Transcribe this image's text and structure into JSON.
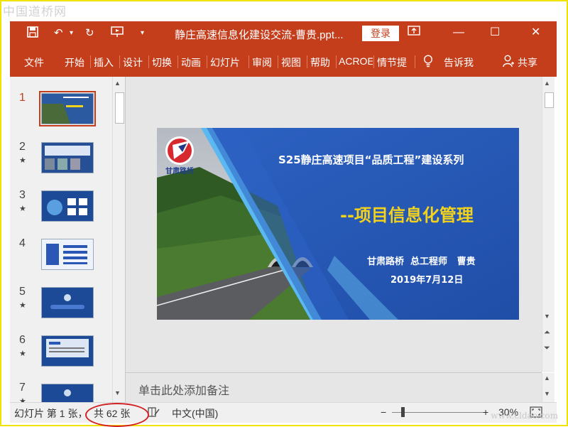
{
  "watermark": {
    "top_left": "中国道桥网",
    "bottom_right": "www.cldao.com"
  },
  "title_bar": {
    "icons": [
      "save-icon",
      "undo-icon",
      "redo-icon",
      "slideshow-icon",
      "customize-icon"
    ],
    "document_title": "静庄高速信息化建设交流-曹贵.ppt...",
    "login_label": "登录",
    "window_controls": [
      "ribbon-display-icon",
      "minimize-icon",
      "maximize-icon",
      "close-icon"
    ]
  },
  "ribbon": {
    "tabs": [
      "文件",
      "开始",
      "插入",
      "设计",
      "切换",
      "动画",
      "幻灯片",
      "审阅",
      "视图",
      "帮助",
      "ACROE",
      "情节提",
      "告诉我"
    ],
    "share_label": "共享",
    "accent_color": "#c43e1c"
  },
  "thumbnails": [
    {
      "num": "1",
      "star": ""
    },
    {
      "num": "2",
      "star": "★"
    },
    {
      "num": "3",
      "star": "★"
    },
    {
      "num": "4",
      "star": ""
    },
    {
      "num": "5",
      "star": "★"
    },
    {
      "num": "6",
      "star": "★"
    },
    {
      "num": "7",
      "star": "★"
    }
  ],
  "slide": {
    "logo_text": "甘肃路桥",
    "title": "S25静庄高速项目“品质工程”建设系列",
    "subtitle": "--项目信息化管理",
    "presenter": "甘肃路桥  总工程师   曹贵",
    "date": "2019年7月12日"
  },
  "notes_placeholder": "单击此处添加备注",
  "status_bar": {
    "slide_info": "幻灯片 第 1 张，",
    "total": "共 62 张",
    "language": "中文(中国)",
    "zoom": "30%",
    "zoom_level": 0.3
  }
}
